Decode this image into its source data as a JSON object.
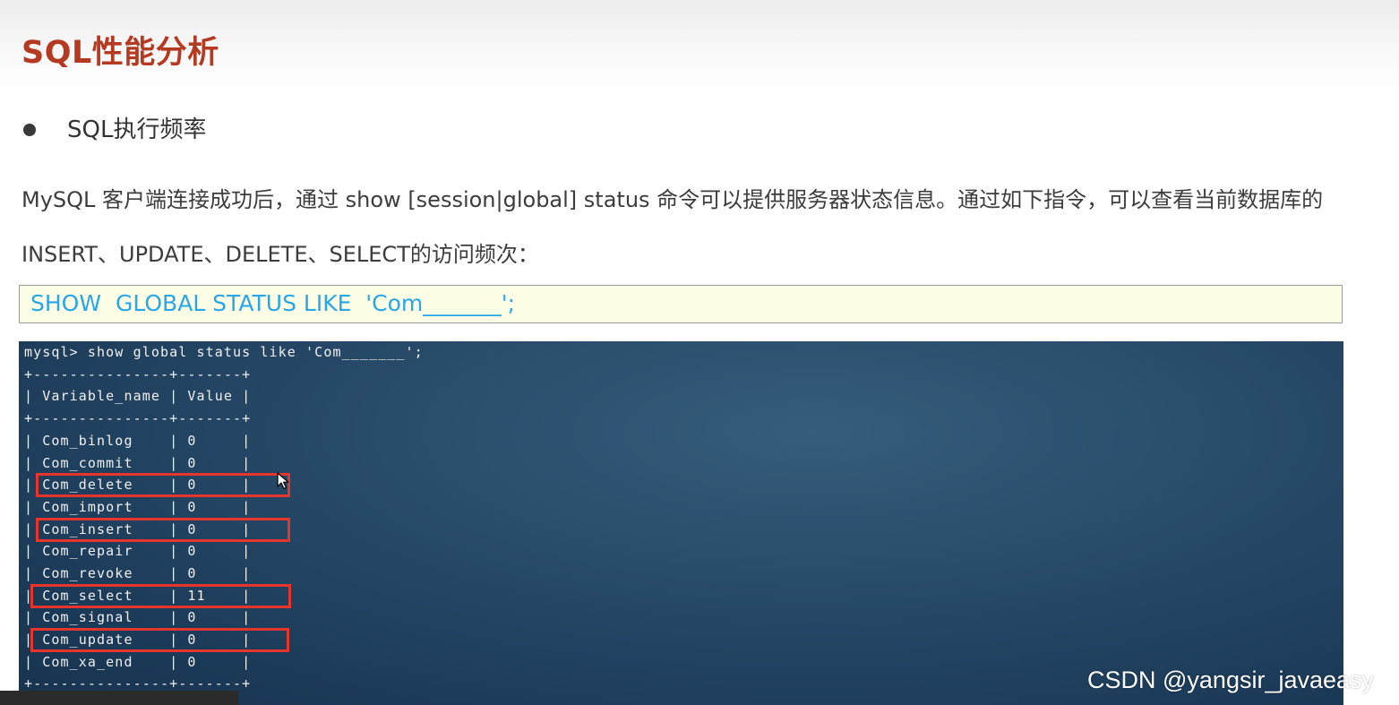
{
  "slide": {
    "title": "SQL性能分析",
    "bullet": "SQL执行频率",
    "description_lines": [
      "MySQL 客户端连接成功后，通过 show [session|global] status 命令可以提供服务器状态信息。通过如下指令，可以查看当前数据库的",
      "INSERT、UPDATE、DELETE、SELECT的访问频次："
    ],
    "code": "SHOW  GLOBAL STATUS LIKE  'Com_______';"
  },
  "terminal": {
    "command": "mysql> show global status like 'Com_______';",
    "border": "+---------------+-------+",
    "header": "| Variable_name | Value |",
    "rows": [
      "| Com_binlog    | 0     |",
      "| Com_commit    | 0     |",
      "| Com_delete    | 0     |",
      "| Com_import    | 0     |",
      "| Com_insert    | 0     |",
      "| Com_repair    | 0     |",
      "| Com_revoke    | 0     |",
      "| Com_select    | 11    |",
      "| Com_signal    | 0     |",
      "| Com_update    | 0     |",
      "| Com_xa_end    | 0     |"
    ],
    "highlighted_rows": [
      "Com_delete",
      "Com_insert",
      "Com_select",
      "Com_update"
    ]
  },
  "watermark": "CSDN @yangsir_javaeasy",
  "colors": {
    "title": "#b53a22",
    "code_text": "#27a6e8",
    "code_bg": "#fefee6",
    "terminal_bg": "#284b69",
    "highlight": "#e8352b"
  },
  "icons": {
    "bullet": "bullet-dot-icon",
    "cursor": "mouse-cursor-icon"
  }
}
